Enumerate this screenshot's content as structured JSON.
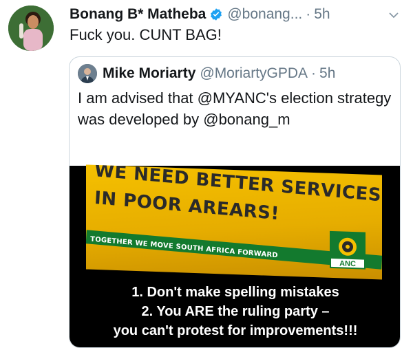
{
  "tweet": {
    "author_name": "Bonang B* Matheba",
    "handle": "@bonang...",
    "separator": "·",
    "time": "5h",
    "text": "Fuck you. CUNT BAG!"
  },
  "quoted_tweet": {
    "author_name": "Mike Moriarty",
    "handle": "@MoriartyGPDA",
    "separator": "·",
    "time": "5h",
    "text": "I am advised that @MYANC's election strategy was developed by @bonang_m",
    "image": {
      "banner_line1": "WE NEED BETTER SERVICES",
      "banner_line2": "IN POOR AREARS!",
      "banner_slogan": "TOGETHER WE MOVE SOUTH AFRICA FORWARD",
      "logo_text": "ANC",
      "caption_lines": [
        "1. Don't make spelling mistakes",
        "2. You ARE the ruling party –",
        "you can't protest for improvements!!!"
      ]
    }
  },
  "colors": {
    "verified": "#1da1f2",
    "muted": "#657786",
    "banner_yellow": "#f5c000",
    "banner_green": "#137a2e"
  },
  "icons": {
    "verified": "verified-badge-icon",
    "menu": "chevron-down-icon"
  }
}
